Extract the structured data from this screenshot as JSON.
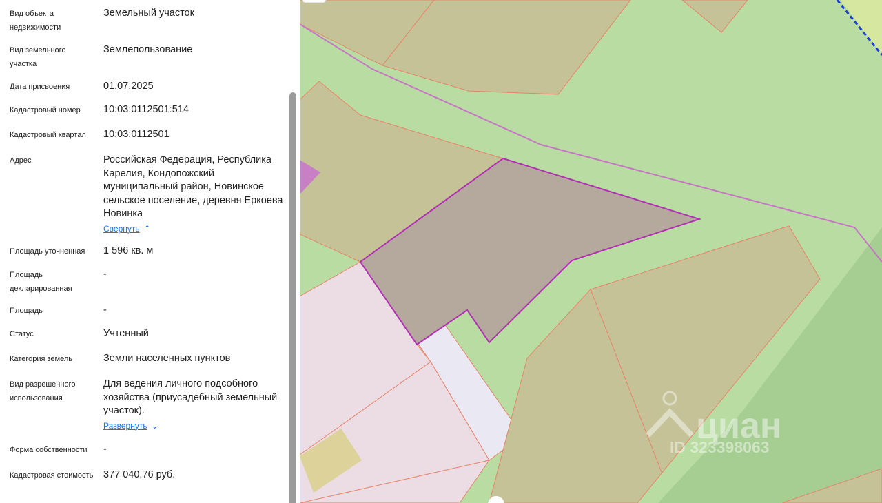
{
  "properties": [
    {
      "label": "Вид объекта недвижимости",
      "value": "Земельный участок"
    },
    {
      "label": "Вид земельного участка",
      "value": "Землепользование"
    },
    {
      "label": "Дата присвоения",
      "value": "01.07.2025"
    },
    {
      "label": "Кадастровый номер",
      "value": "10:03:0112501:514"
    },
    {
      "label": "Кадастровый квартал",
      "value": "10:03:0112501"
    },
    {
      "label": "Адрес",
      "value": "Российская Федерация, Республика Карелия, Кондопожский муниципальный район, Новинское сельское поселение, деревня Еркоева Новинка",
      "link": "Свернуть"
    },
    {
      "label": "Площадь уточненная",
      "value": "1 596 кв. м"
    },
    {
      "label": "Площадь декларированная",
      "value": "-"
    },
    {
      "label": "Площадь",
      "value": "-"
    },
    {
      "label": "Статус",
      "value": "Учтенный"
    },
    {
      "label": "Категория земель",
      "value": "Земли населенных пунктов"
    },
    {
      "label": "Вид разрешенного использования",
      "value": "Для ведения личного подсобного хозяйства (приусадебный земельный участок).",
      "link": "Развернуть"
    },
    {
      "label": "Форма собственности",
      "value": "-"
    },
    {
      "label": "Кадастровая стоимость",
      "value": "377 040,76 руб."
    }
  ],
  "watermark": {
    "brand": "циан",
    "id_text": "ID 323398063"
  },
  "colors": {
    "map_base": "#b9dca3",
    "parcel_fill": "#c4c296",
    "parcel_stroke": "#e8826a",
    "selected_fill": "#b5a89c",
    "selected_stroke": "#b22fb5",
    "pink_area": "#ecdce3",
    "link": "#1a73e8",
    "boundary_dash": "#1e3fd6"
  }
}
